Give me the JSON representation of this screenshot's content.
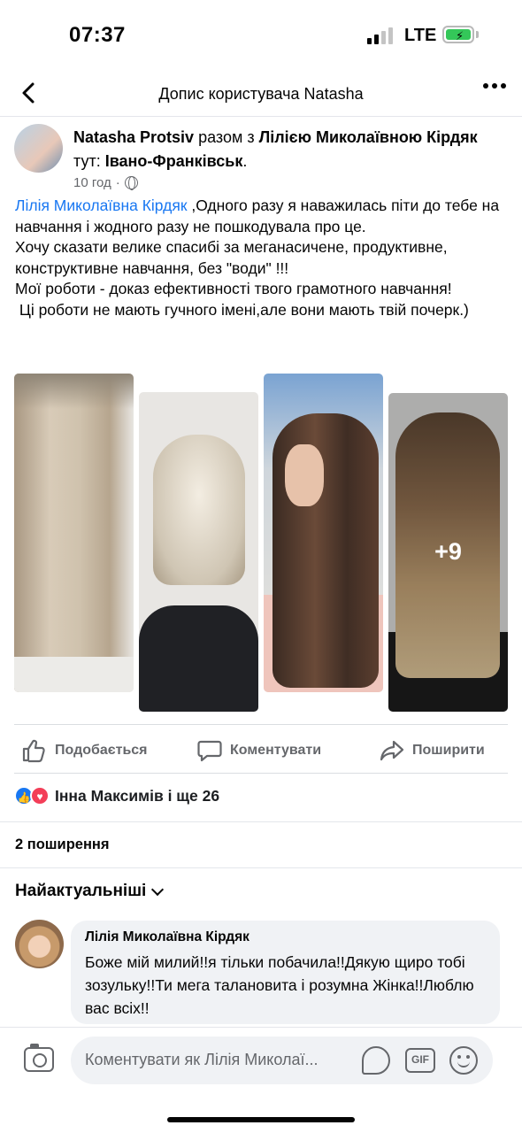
{
  "status": {
    "time": "07:37",
    "network": "LTE",
    "battery_color": "#34c759"
  },
  "topbar": {
    "title": "Допис користувача Natasha",
    "back_icon": "chevron-left-icon",
    "more_icon": "more-dots-icon"
  },
  "post": {
    "author": "Natasha Protsiv",
    "with_word": "разом з",
    "tagged": "Лілією Миколаївною Кірдяк",
    "at_word": "тут:",
    "location": "Івано-Франківськ",
    "location_suffix": ".",
    "time": "10 год",
    "time_sep": "·",
    "privacy_icon": "globe-icon",
    "mention": "Лілія Миколаївна Кірдяк",
    "text": " ,Одного разу я наважилась піти до тебе на навчання і жодного разу не пошкодувала про це.\nХочу сказати велике спасибі за меганасичене, продуктивне, конструктивне навчання, без \"води\" !!!\nМої роботи - доказ ефективності твого грамотного навчання!\n Ці роботи не мають гучного імені,але вони мають твій почерк.)",
    "extra_photos": "+9",
    "accent_color": "#1877f2"
  },
  "actions": {
    "like": "Подобається",
    "comment": "Коментувати",
    "share": "Поширити"
  },
  "reactions": {
    "like_glyph": "👍",
    "love_glyph": "♥",
    "summary": "Інна Максимів і ще 26"
  },
  "shares": "2 поширення",
  "sort": "Найактуальніші",
  "comment": {
    "author": "Лілія Миколаївна Кірдяк",
    "text": "Боже мій милий!!я тільки побачила!!Дякую щиро тобі зозульку!!Ти мега талановита і розумна Жінка!!Люблю вас всіх!!"
  },
  "composer": {
    "placeholder": "Коментувати як Лілія Миколаї...",
    "gif": "GIF"
  }
}
